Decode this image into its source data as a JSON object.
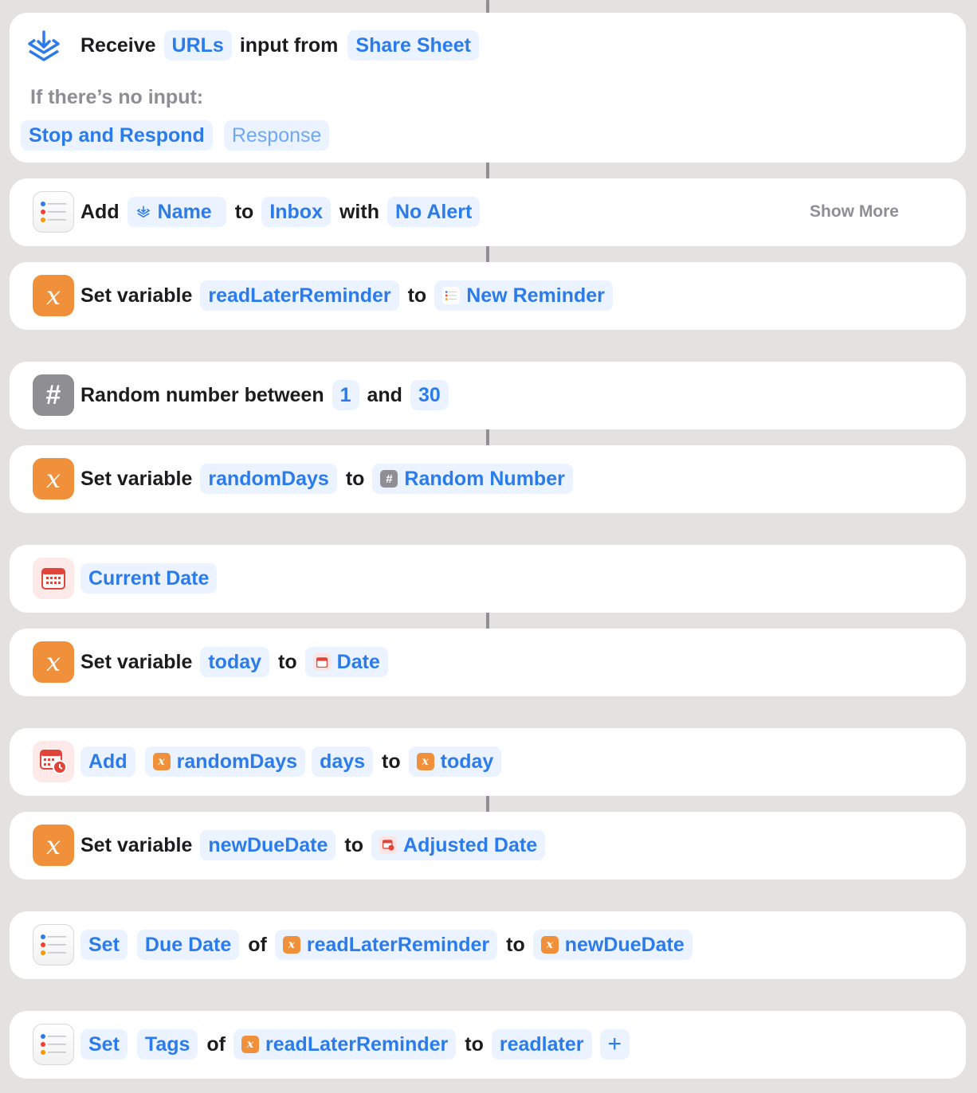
{
  "receive": {
    "word_receive": "Receive",
    "type": "URLs",
    "word_input_from": "input from",
    "source": "Share Sheet",
    "no_input_label": "If there’s no input:",
    "stop": "Stop and Respond",
    "response": "Response"
  },
  "add_reminder": {
    "word_add": "Add",
    "name": "Name",
    "word_to": "to",
    "list": "Inbox",
    "word_with": "with",
    "alert": "No Alert",
    "show_more": "Show More"
  },
  "set_var_1": {
    "label": "Set variable",
    "name": "readLaterReminder",
    "word_to": "to",
    "value": "New Reminder"
  },
  "random": {
    "label": "Random number between",
    "min": "1",
    "word_and": "and",
    "max": "30"
  },
  "set_var_2": {
    "label": "Set variable",
    "name": "randomDays",
    "word_to": "to",
    "value": "Random Number"
  },
  "current_date": {
    "label": "Current Date"
  },
  "set_var_3": {
    "label": "Set variable",
    "name": "today",
    "word_to": "to",
    "value": "Date"
  },
  "adjust_date": {
    "op": "Add",
    "amount": "randomDays",
    "unit": "days",
    "word_to": "to",
    "target": "today"
  },
  "set_var_4": {
    "label": "Set variable",
    "name": "newDueDate",
    "word_to": "to",
    "value": "Adjusted Date"
  },
  "set_due": {
    "verb": "Set",
    "field": "Due Date",
    "word_of": "of",
    "reminder": "readLaterReminder",
    "word_to": "to",
    "value": "newDueDate"
  },
  "set_tags": {
    "verb": "Set",
    "field": "Tags",
    "word_of": "of",
    "reminder": "readLaterReminder",
    "word_to": "to",
    "value": "readlater",
    "add": "+"
  },
  "icons": {
    "orange_var_glyph": "x",
    "hash_glyph": "#"
  },
  "colors": {
    "accent": "#2b7bea",
    "token_bg": "#eaf3ff",
    "variable": "#f0903a",
    "background": "#e3e2e0"
  }
}
